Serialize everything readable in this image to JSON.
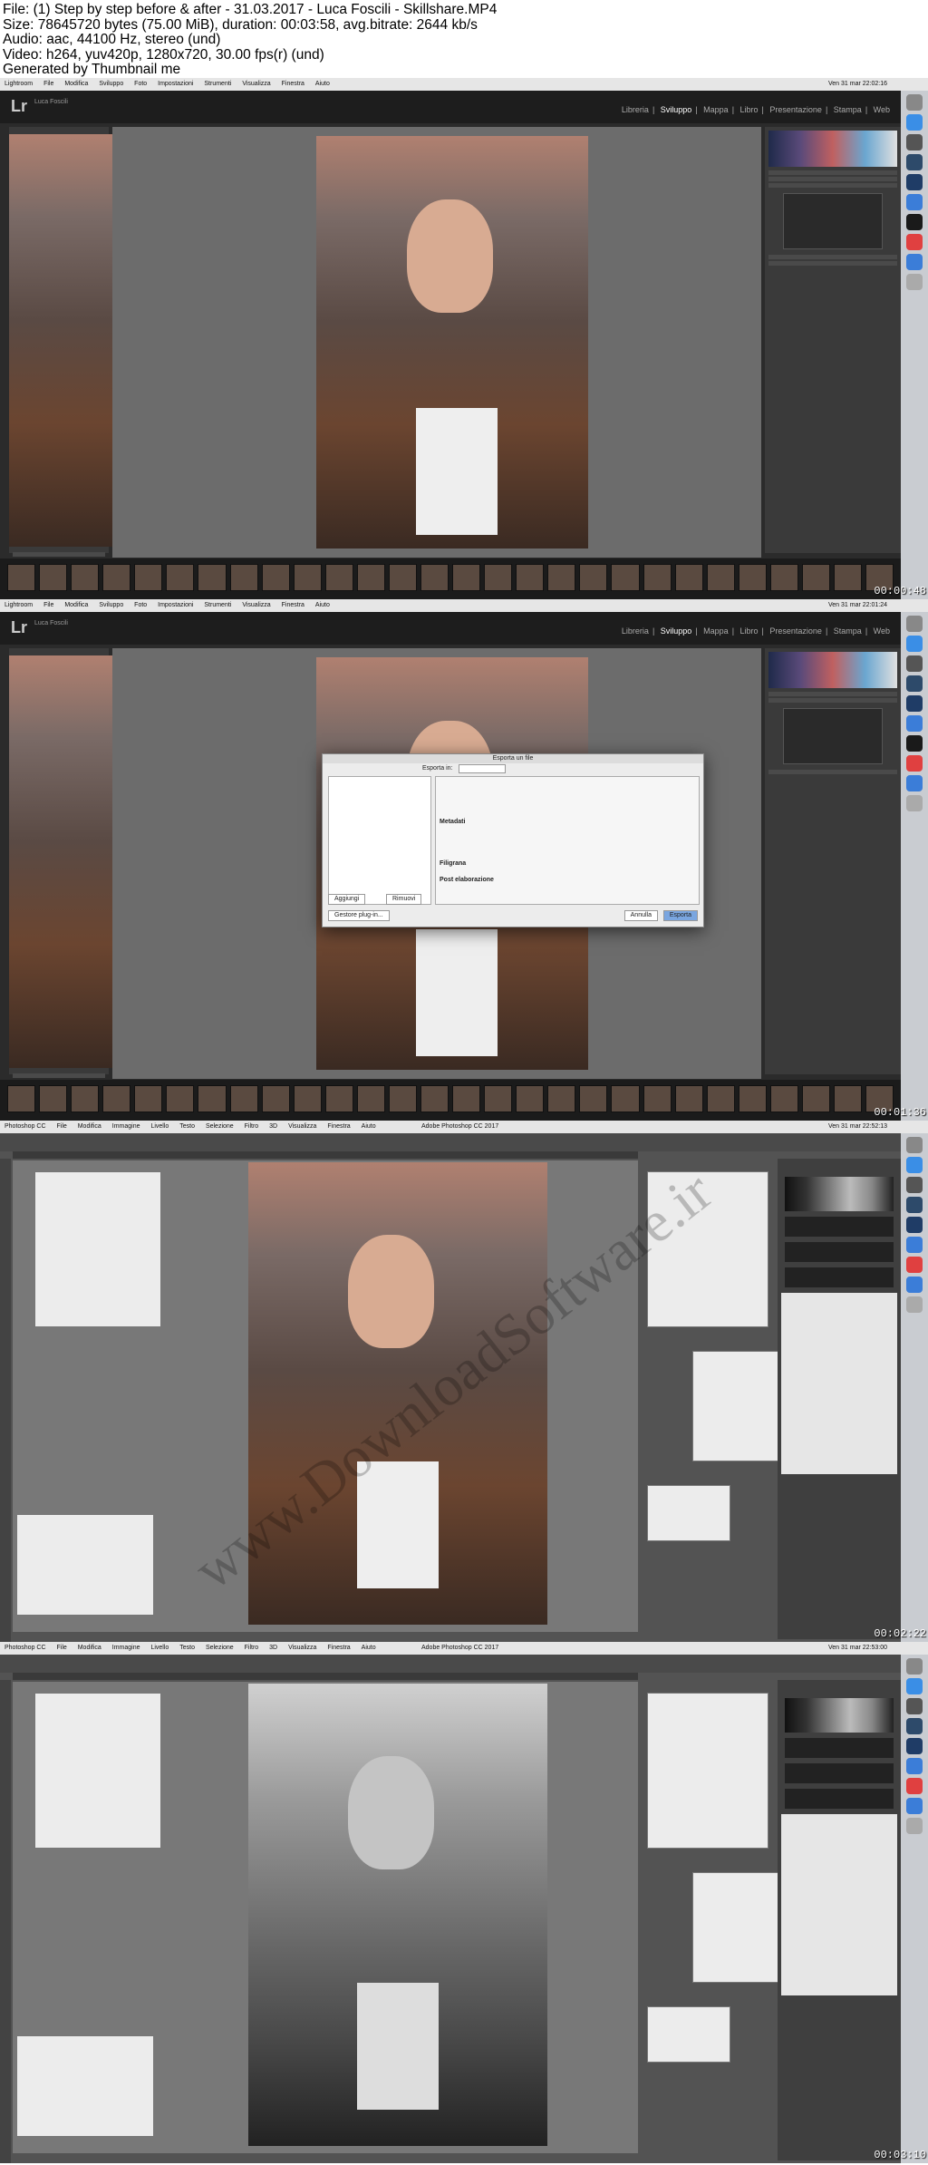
{
  "header": {
    "line1": "File: (1) Step by step before & after - 31.03.2017 - Luca Foscili - Skillshare.MP4",
    "line2": "Size: 78645720 bytes (75.00 MiB), duration: 00:03:58, avg.bitrate: 2644 kb/s",
    "line3": "Audio: aac, 44100 Hz, stereo (und)",
    "line4": "Video: h264, yuv420p, 1280x720, 30.00 fps(r) (und)",
    "line5": "Generated by Thumbnail me"
  },
  "frames": [
    {
      "app": "Lightroom",
      "timestamp": "00:00:48",
      "menubar": [
        "Lightroom",
        "File",
        "Modifica",
        "Sviluppo",
        "Foto",
        "Impostazioni",
        "Strumenti",
        "Visualizza",
        "Finestra",
        "Aiuto"
      ],
      "clock": "Ven 31 mar  22:02:16",
      "user": "Luca Foscili",
      "modules": [
        "Libreria",
        "Sviluppo",
        "Mappa",
        "Libro",
        "Presentazione",
        "Stampa",
        "Web"
      ],
      "active_module": "Sviluppo"
    },
    {
      "app": "Lightroom",
      "timestamp": "00:01:36",
      "menubar": [
        "Lightroom",
        "File",
        "Modifica",
        "Sviluppo",
        "Foto",
        "Impostazioni",
        "Strumenti",
        "Visualizza",
        "Finestra",
        "Aiuto"
      ],
      "clock": "Ven 31 mar  22:01:24",
      "user": "Luca Foscili",
      "modules": [
        "Libreria",
        "Sviluppo",
        "Mappa",
        "Libro",
        "Presentazione",
        "Stampa",
        "Web"
      ],
      "active_module": "Sviluppo",
      "dialog": {
        "title": "Esporta un file",
        "export_to": "Esporta in:",
        "sections": [
          "Metadati",
          "Filigrana",
          "Post elaborazione"
        ],
        "buttons": [
          "Aggiungi",
          "Rimuovi",
          "Gestore plug-in...",
          "Annulla",
          "Esporta"
        ]
      }
    },
    {
      "app": "Photoshop CC",
      "timestamp": "00:02:22",
      "menubar": [
        "Photoshop CC",
        "File",
        "Modifica",
        "Immagine",
        "Livello",
        "Testo",
        "Selezione",
        "Filtro",
        "3D",
        "Visualizza",
        "Finestra",
        "Aiuto"
      ],
      "title": "Adobe Photoshop CC 2017",
      "clock": "Ven 31 mar  22:52:13"
    },
    {
      "app": "Photoshop CC",
      "timestamp": "00:03:10",
      "menubar": [
        "Photoshop CC",
        "File",
        "Modifica",
        "Immagine",
        "Livello",
        "Testo",
        "Selezione",
        "Filtro",
        "3D",
        "Visualizza",
        "Finestra",
        "Aiuto"
      ],
      "title": "Adobe Photoshop CC 2017",
      "clock": "Ven 31 mar  22:53:00"
    }
  ],
  "watermark": "www.DownloadSoftware.ir"
}
